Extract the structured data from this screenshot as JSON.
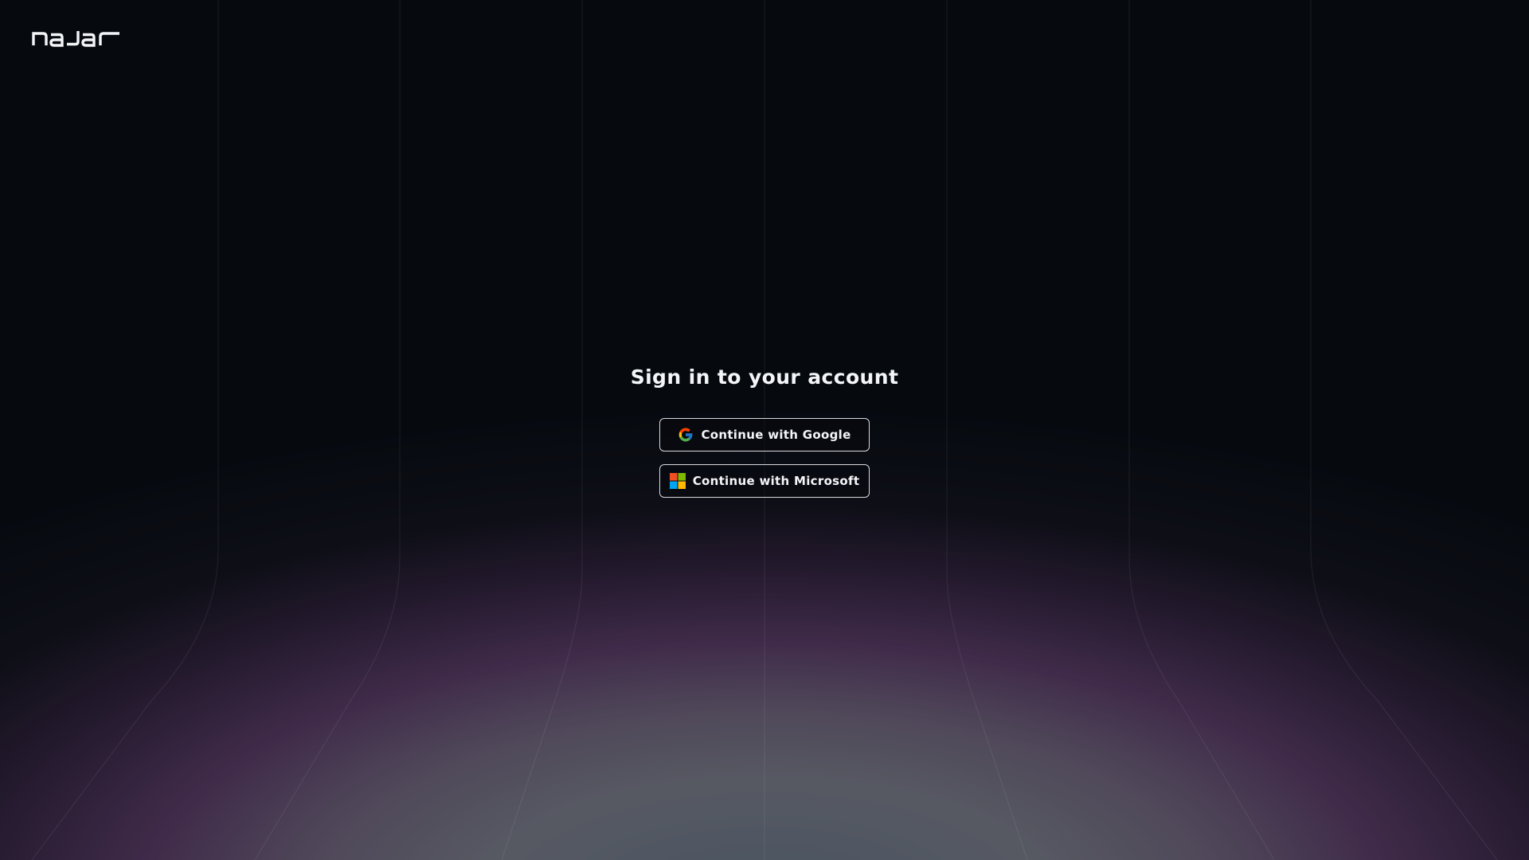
{
  "brand": {
    "logo_text": "najar"
  },
  "signin": {
    "title": "Sign in to your account",
    "google_label": "Continue with Google",
    "microsoft_label": "Continue with Microsoft"
  },
  "icons": {
    "logo": "najar-logo",
    "google": "google-icon",
    "microsoft": "microsoft-icon"
  },
  "colors": {
    "background": "#060a0f",
    "glow_purple": "#4a3154",
    "glow_gray": "#5b5c66",
    "text": "#f4f5f7",
    "button_border": "#d8dadf"
  }
}
